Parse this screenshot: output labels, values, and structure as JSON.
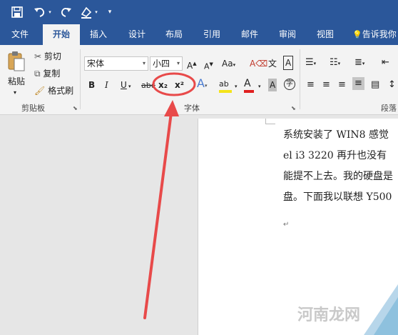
{
  "qat": {
    "save_icon": "save-icon",
    "undo_icon": "undo-icon",
    "redo_icon": "redo-icon",
    "format_painter_icon": "format-painter-icon",
    "customize_icon": "chevron-down-icon"
  },
  "tabs": [
    {
      "label": "文件"
    },
    {
      "label": "开始",
      "active": true
    },
    {
      "label": "插入"
    },
    {
      "label": "设计"
    },
    {
      "label": "布局"
    },
    {
      "label": "引用"
    },
    {
      "label": "邮件"
    },
    {
      "label": "审阅"
    },
    {
      "label": "视图"
    },
    {
      "label": "告诉我你"
    }
  ],
  "clipboard": {
    "paste_label": "粘贴",
    "cut_label": "剪切",
    "copy_label": "复制",
    "format_painter_label": "格式刷",
    "group_label": "剪贴板"
  },
  "font": {
    "font_name": "宋体",
    "font_size": "小四",
    "grow_label": "A",
    "shrink_label": "A",
    "change_case_label": "Aa",
    "bold_label": "B",
    "italic_label": "I",
    "underline_label": "U",
    "strike_label": "abc",
    "subscript_label": "x₂",
    "superscript_label": "x²",
    "group_label": "字体"
  },
  "paragraph": {
    "group_label": "段落"
  },
  "document": {
    "lines": [
      "系统安装了 WIN8 感觉",
      "el  i3  3220 再升也没有",
      "能提不上去。我的硬盘是",
      "盘。下面我以联想 Y500"
    ]
  },
  "watermark": {
    "text": "河南龙网"
  },
  "colors": {
    "accent": "#2b579a",
    "annotation": "#e84a4a"
  }
}
